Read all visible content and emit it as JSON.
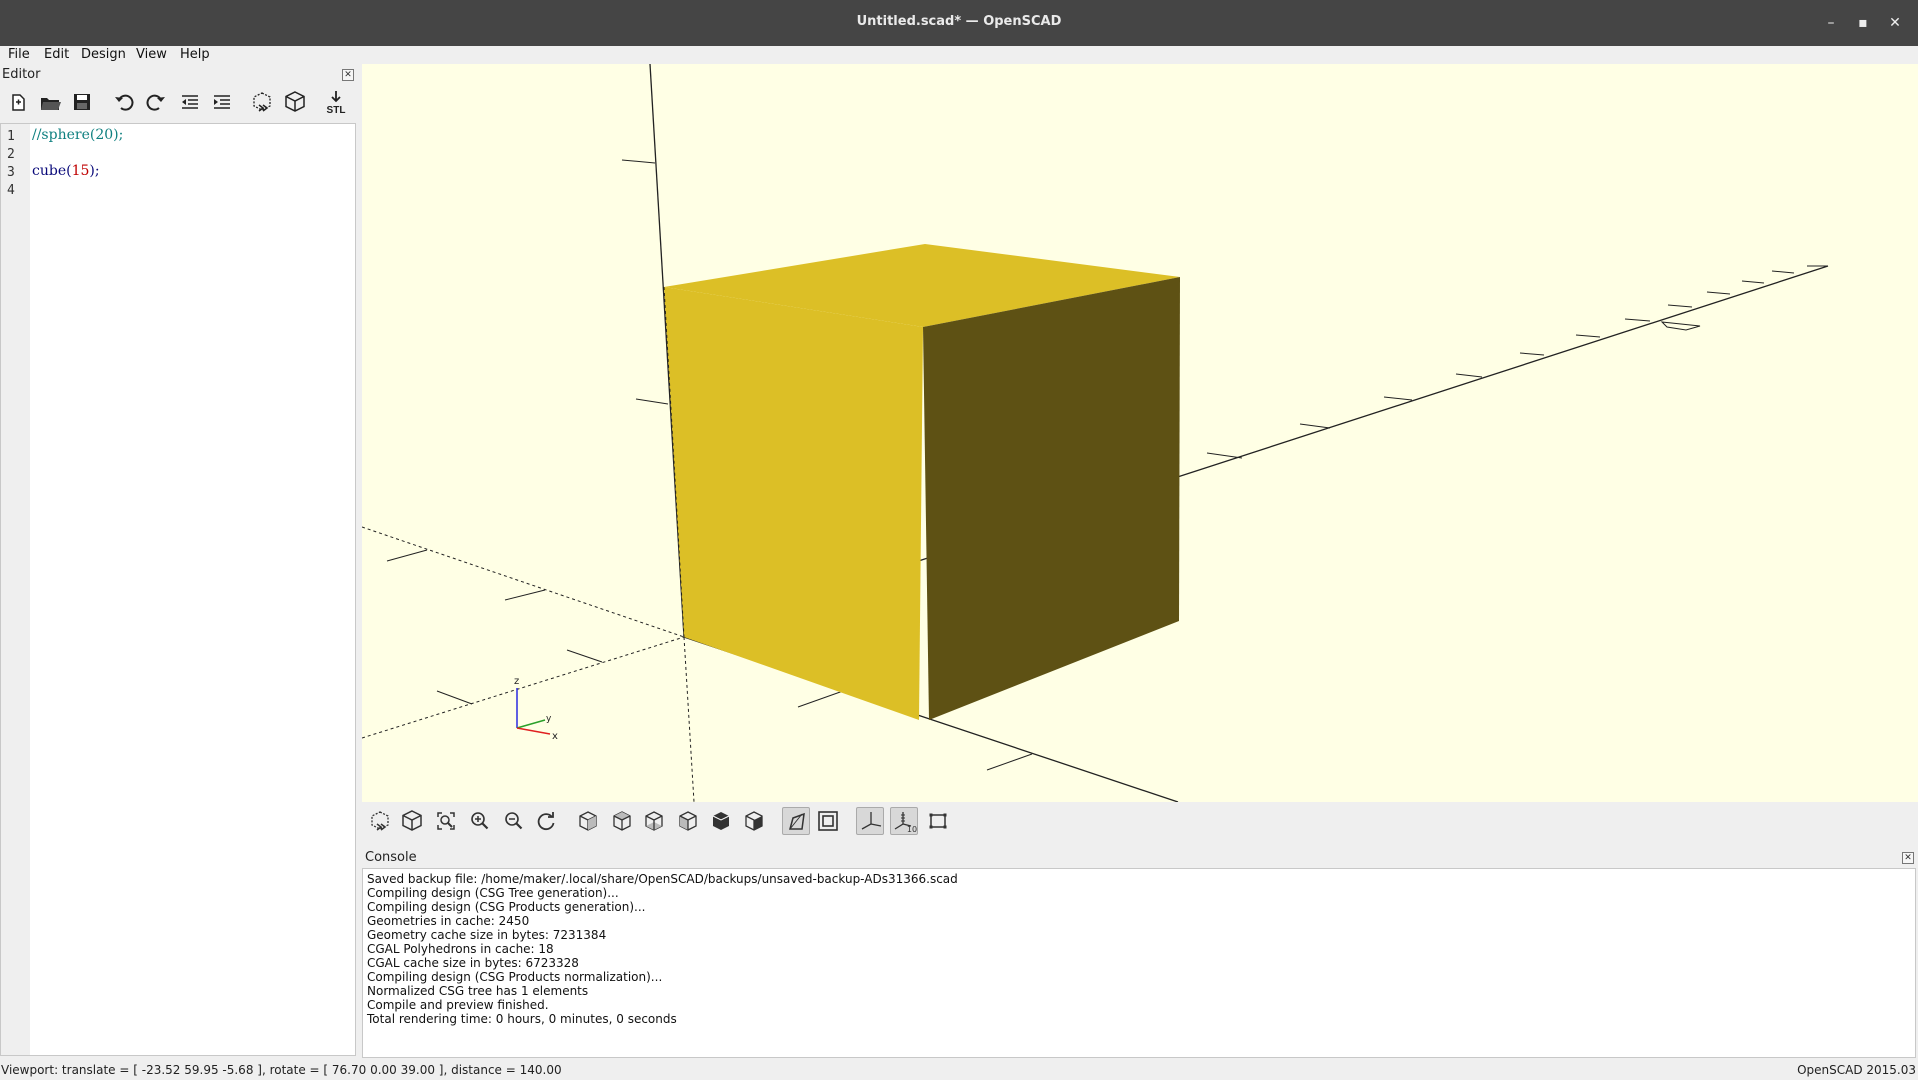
{
  "window": {
    "title": "Untitled.scad* — OpenSCAD",
    "minimize": "–",
    "maximize": "▪",
    "close": "✕"
  },
  "menu": [
    "File",
    "Edit",
    "Design",
    "View",
    "Help"
  ],
  "editor": {
    "title": "Editor",
    "close": "✕",
    "toolbar_icons": [
      "new-file-icon",
      "open-file-icon",
      "save-file-icon",
      "undo-icon",
      "redo-icon",
      "unindent-icon",
      "indent-icon",
      "preview-icon",
      "render-icon",
      "export-stl-icon"
    ],
    "stl_label": "STL",
    "line_numbers": [
      "1",
      "2",
      "3",
      "4"
    ],
    "code": {
      "line1": "//sphere(20);",
      "line3_fn": "cube(",
      "line3_arg": "15",
      "line3_end": ");"
    }
  },
  "viewport": {
    "background": "#ffffe5",
    "cube_front": "#dcbf26",
    "cube_side": "#5e5114",
    "axis_labels": {
      "z": "z",
      "y": "y",
      "x": "x"
    }
  },
  "view_toolbar": {
    "icons": [
      "preview-icon",
      "render-icon",
      "view-all-icon",
      "zoom-in-icon",
      "zoom-out-icon",
      "reset-view-icon",
      "view-right-icon",
      "view-top-icon",
      "view-bottom-icon",
      "view-left-icon",
      "view-front-icon",
      "view-back-icon",
      "perspective-icon",
      "orthogonal-icon",
      "show-axes-icon",
      "show-scale-markers-icon",
      "show-edges-icon"
    ],
    "scale_label": "10"
  },
  "console": {
    "title": "Console",
    "close": "✕",
    "lines": [
      "Saved backup file: /home/maker/.local/share/OpenSCAD/backups/unsaved-backup-ADs31366.scad",
      "Compiling design (CSG Tree generation)...",
      "Compiling design (CSG Products generation)...",
      "Geometries in cache: 2450",
      "Geometry cache size in bytes: 7231384",
      "CGAL Polyhedrons in cache: 18",
      "CGAL cache size in bytes: 6723328",
      "Compiling design (CSG Products normalization)...",
      "Normalized CSG tree has 1 elements",
      "Compile and preview finished.",
      "Total rendering time: 0 hours, 0 minutes, 0 seconds"
    ]
  },
  "status": {
    "viewport": "Viewport: translate = [ -23.52 59.95 -5.68 ], rotate = [ 76.70 0.00 39.00 ], distance = 140.00",
    "version": "OpenSCAD 2015.03"
  }
}
